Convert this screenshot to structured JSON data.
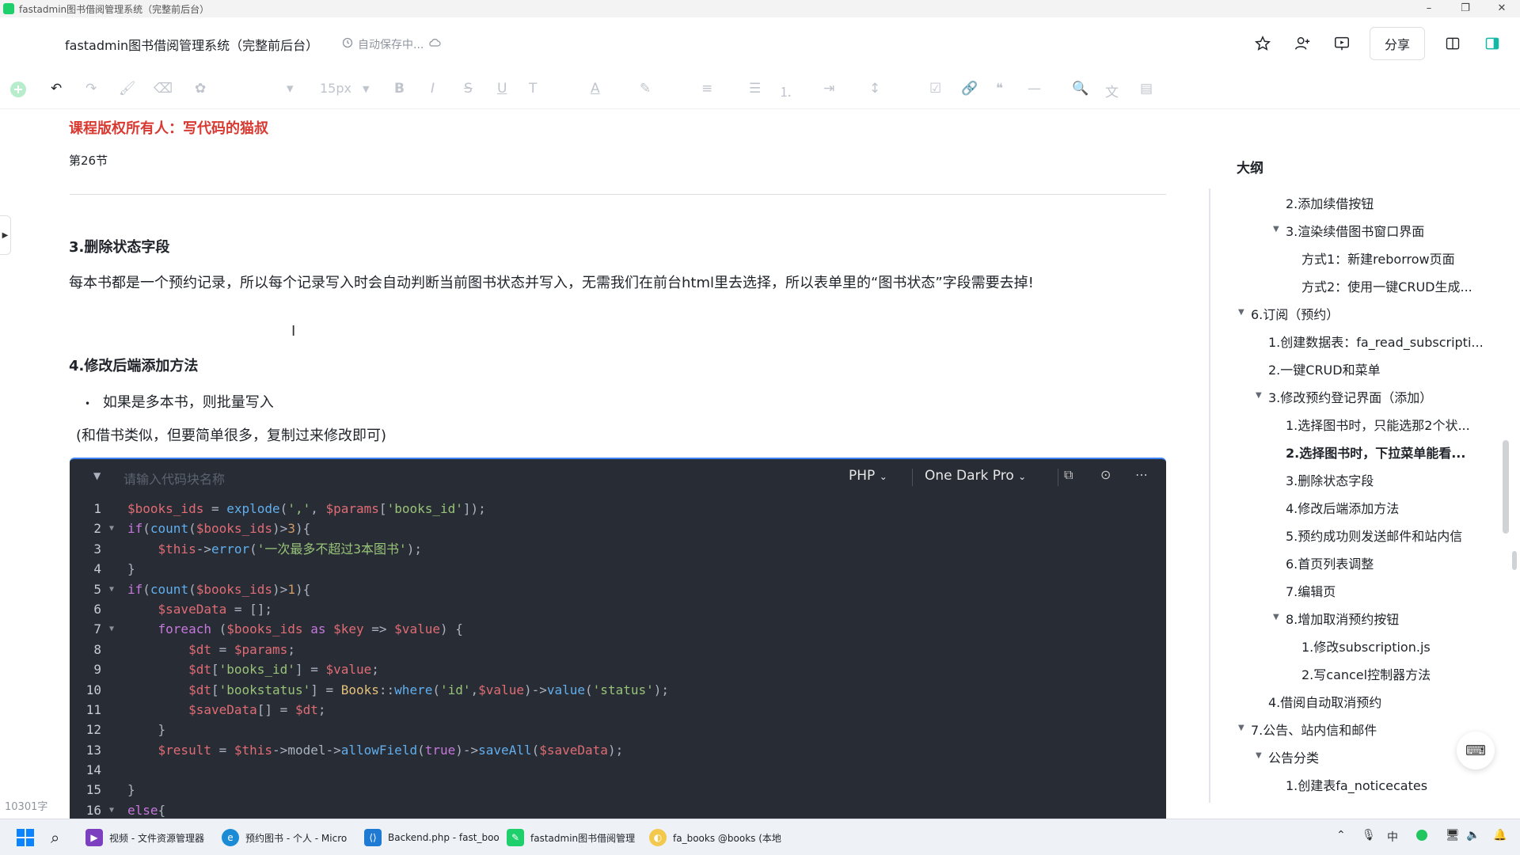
{
  "window": {
    "title": "fastadmin图书借阅管理系统（完整前后台）",
    "controls": [
      "–",
      "❐",
      "✕"
    ]
  },
  "header": {
    "doc_title": "fastadmin图书借阅管理系统（完整前后台）",
    "autosave": "自动保存中...",
    "share_label": "分享"
  },
  "toolbar": {
    "font_size": "15px"
  },
  "doc": {
    "copyright": "课程版权所有人：写代码的猫叔",
    "section_no": "第26节",
    "h_delete": "3.删除状态字段",
    "p_delete": "每本书都是一个预约记录，所以每个记录写入时会自动判断当前图书状态并写入，无需我们在前台html里去选择，所以表单里的“图书状态”字段需要去掉!",
    "h_modify": "4.修改后端添加方法",
    "bullet": "如果是多本书，则批量写入",
    "note": "(和借书类似，但要简单很多，复制过来修改即可)"
  },
  "codeblock": {
    "name_placeholder": "请输入代码块名称",
    "language": "PHP",
    "theme": "One Dark Pro",
    "line_numbers": [
      "1",
      "2",
      "3",
      "4",
      "5",
      "6",
      "7",
      "8",
      "9",
      "10",
      "11",
      "12",
      "13",
      "14",
      "15",
      "16"
    ],
    "lines": [
      "$books_ids = explode(',', $params['books_id']);",
      "if(count($books_ids)>3){",
      "    $this->error('一次最多不超过3本图书');",
      "}",
      "if(count($books_ids)>1){",
      "    $saveData = [];",
      "    foreach ($books_ids as $key => $value) {",
      "        $dt = $params;",
      "        $dt['books_id'] = $value;",
      "        $dt['bookstatus'] = Books::where('id',$value)->value('status');",
      "        $saveData[] = $dt;",
      "    }",
      "    $result = $this->model->allowField(true)->saveAll($saveData);",
      "",
      "}",
      "else{"
    ]
  },
  "word_count": "10301字",
  "outline": {
    "title": "大纲",
    "items": [
      {
        "label": "2.添加续借按钮"
      },
      {
        "label": "3.渲染续借图书窗口界面"
      },
      {
        "label": "方式1：新建reborrow页面"
      },
      {
        "label": "方式2：使用一键CRUD生成..."
      },
      {
        "label": "6.订阅（预约）"
      },
      {
        "label": "1.创建数据表：fa_read_subscripti..."
      },
      {
        "label": "2.一键CRUD和菜单"
      },
      {
        "label": "3.修改预约登记界面（添加）"
      },
      {
        "label": "1.选择图书时，只能选那2个状..."
      },
      {
        "label": "2.选择图书时，下拉菜单能看..."
      },
      {
        "label": "3.删除状态字段"
      },
      {
        "label": "4.修改后端添加方法"
      },
      {
        "label": "5.预约成功则发送邮件和站内信"
      },
      {
        "label": "6.首页列表调整"
      },
      {
        "label": "7.编辑页"
      },
      {
        "label": "8.增加取消预约按钮"
      },
      {
        "label": "1.修改subscription.js"
      },
      {
        "label": "2.写cancel控制器方法"
      },
      {
        "label": "4.借阅自动取消预约"
      },
      {
        "label": "7.公告、站内信和邮件"
      },
      {
        "label": "公告分类"
      },
      {
        "label": "1.创建表fa_noticecates"
      }
    ]
  },
  "taskbar": {
    "items": [
      {
        "label": "视频 - 文件资源管理器"
      },
      {
        "label": "预约图书 - 个人 - Micro"
      },
      {
        "label": "Backend.php - fast_boo"
      },
      {
        "label": "fastadmin图书借阅管理"
      },
      {
        "label": "fa_books @books (本地"
      }
    ],
    "ime": "中"
  },
  "colors": {
    "accent": "#d83931",
    "code_bg": "#282c34"
  }
}
